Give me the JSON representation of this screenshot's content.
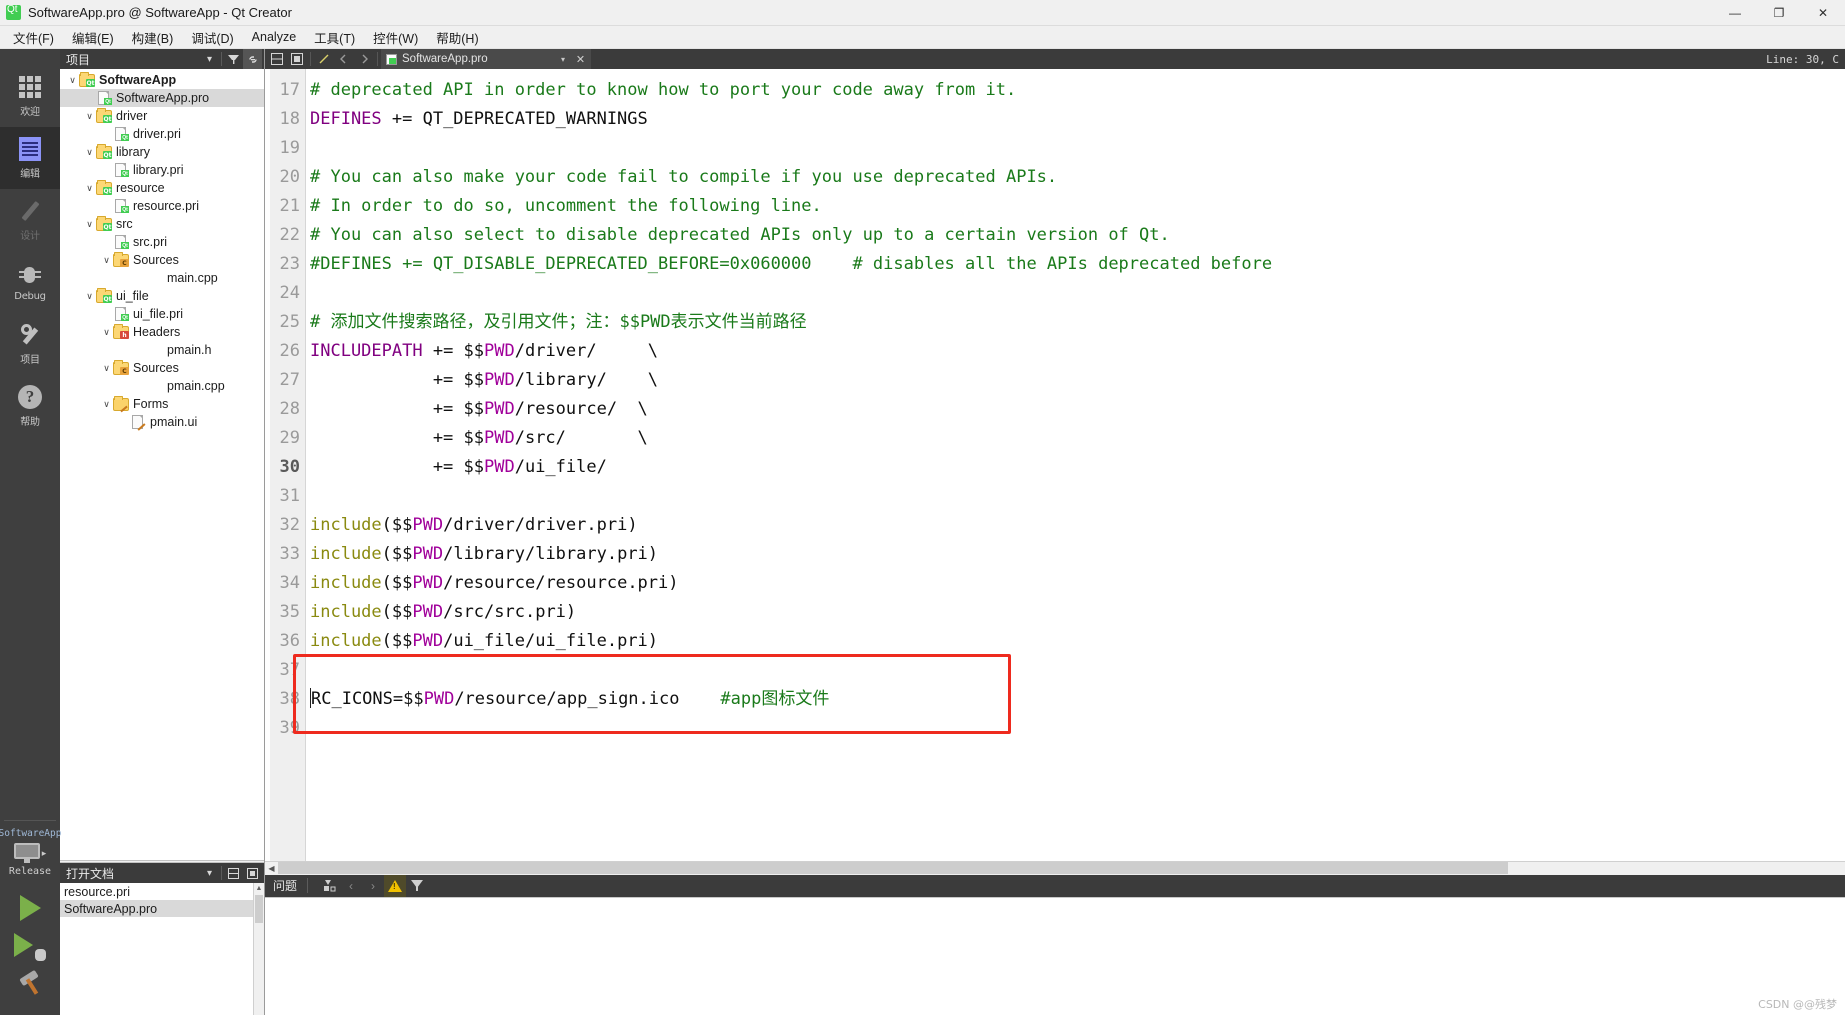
{
  "window": {
    "title": "SoftwareApp.pro @ SoftwareApp - Qt Creator",
    "logo_label": "Qt",
    "minimize": "—",
    "maximize": "❐",
    "close": "✕"
  },
  "menubar": {
    "items": [
      {
        "label": "文件(F)",
        "mnemonic": "F"
      },
      {
        "label": "编辑(E)",
        "mnemonic": "E"
      },
      {
        "label": "构建(B)",
        "mnemonic": "B"
      },
      {
        "label": "调试(D)",
        "mnemonic": "D"
      },
      {
        "label": "Analyze",
        "mnemonic": "A"
      },
      {
        "label": "工具(T)",
        "mnemonic": "T"
      },
      {
        "label": "控件(W)",
        "mnemonic": "W"
      },
      {
        "label": "帮助(H)",
        "mnemonic": "H"
      }
    ]
  },
  "modebar": {
    "modes": [
      {
        "label": "欢迎",
        "icon": "grid-icon",
        "state": "normal"
      },
      {
        "label": "编辑",
        "icon": "document-icon",
        "state": "active"
      },
      {
        "label": "设计",
        "icon": "pencil-icon",
        "state": "disabled"
      },
      {
        "label": "Debug",
        "icon": "bug-icon",
        "state": "normal"
      },
      {
        "label": "项目",
        "icon": "wrench-icon",
        "state": "normal"
      },
      {
        "label": "帮助",
        "icon": "question-icon",
        "state": "normal"
      }
    ],
    "kit": {
      "project_name": "SoftwareApp",
      "build_config": "Release",
      "expand_arrow": "▸"
    },
    "actions": [
      {
        "name": "run-button",
        "label": "Run"
      },
      {
        "name": "debug-button",
        "label": "Start Debugging"
      },
      {
        "name": "build-button",
        "label": "Build"
      }
    ]
  },
  "project_panel": {
    "title": "项目",
    "dropdown_arrow": "▾",
    "filter_icon": "filter-icon",
    "link_icon": "link-icon",
    "tree": [
      {
        "label": "SoftwareApp",
        "indent": 0,
        "twist": "∨",
        "icon": "folder-qt",
        "bold": true,
        "selected": false
      },
      {
        "label": "SoftwareApp.pro",
        "indent": 1,
        "twist": "",
        "icon": "file-qt",
        "bold": false,
        "selected": true
      },
      {
        "label": "driver",
        "indent": 1,
        "twist": "∨",
        "icon": "folder-qt",
        "bold": false,
        "selected": false
      },
      {
        "label": "driver.pri",
        "indent": 2,
        "twist": "",
        "icon": "file-qt",
        "bold": false,
        "selected": false
      },
      {
        "label": "library",
        "indent": 1,
        "twist": "∨",
        "icon": "folder-qt",
        "bold": false,
        "selected": false
      },
      {
        "label": "library.pri",
        "indent": 2,
        "twist": "",
        "icon": "file-qt",
        "bold": false,
        "selected": false
      },
      {
        "label": "resource",
        "indent": 1,
        "twist": "∨",
        "icon": "folder-qt",
        "bold": false,
        "selected": false
      },
      {
        "label": "resource.pri",
        "indent": 2,
        "twist": "",
        "icon": "file-qt",
        "bold": false,
        "selected": false
      },
      {
        "label": "src",
        "indent": 1,
        "twist": "∨",
        "icon": "folder-qt",
        "bold": false,
        "selected": false
      },
      {
        "label": "src.pri",
        "indent": 2,
        "twist": "",
        "icon": "file-qt",
        "bold": false,
        "selected": false
      },
      {
        "label": "Sources",
        "indent": 2,
        "twist": "∨",
        "icon": "folder-cpp",
        "bold": false,
        "selected": false
      },
      {
        "label": "main.cpp",
        "indent": 4,
        "twist": "",
        "icon": "none",
        "bold": false,
        "selected": false
      },
      {
        "label": "ui_file",
        "indent": 1,
        "twist": "∨",
        "icon": "folder-qt",
        "bold": false,
        "selected": false
      },
      {
        "label": "ui_file.pri",
        "indent": 2,
        "twist": "",
        "icon": "file-qt",
        "bold": false,
        "selected": false
      },
      {
        "label": "Headers",
        "indent": 2,
        "twist": "∨",
        "icon": "folder-h",
        "bold": false,
        "selected": false
      },
      {
        "label": "pmain.h",
        "indent": 4,
        "twist": "",
        "icon": "none",
        "bold": false,
        "selected": false
      },
      {
        "label": "Sources",
        "indent": 2,
        "twist": "∨",
        "icon": "folder-cpp",
        "bold": false,
        "selected": false
      },
      {
        "label": "pmain.cpp",
        "indent": 4,
        "twist": "",
        "icon": "none",
        "bold": false,
        "selected": false
      },
      {
        "label": "Forms",
        "indent": 2,
        "twist": "∨",
        "icon": "folder-forms",
        "bold": false,
        "selected": false
      },
      {
        "label": "pmain.ui",
        "indent": 3,
        "twist": "",
        "icon": "file-ui",
        "bold": false,
        "selected": false
      }
    ]
  },
  "open_documents": {
    "title": "打开文档",
    "dropdown_arrow": "▾",
    "split_icon": "split-icon",
    "close_icon": "close-split-icon",
    "items": [
      {
        "label": "resource.pri",
        "selected": false
      },
      {
        "label": "SoftwareApp.pro",
        "selected": true
      }
    ]
  },
  "editor": {
    "toolbar": {
      "split_icon": "split-editor-icon",
      "unsplit_icon": "remove-split-icon",
      "bookmark_icon": "bookmark-icon",
      "back_icon": "navigate-back-icon",
      "forward_icon": "navigate-forward-icon"
    },
    "tab": {
      "filename": "SoftwareApp.pro",
      "dropdown": "▾",
      "close": "✕"
    },
    "status": "Line: 30, C",
    "first_line_number": 17,
    "current_line": 30,
    "lines": [
      {
        "n": 17,
        "tokens": [
          {
            "t": "# deprecated API in order to know how to port your code away from it.",
            "c": "cmt"
          }
        ]
      },
      {
        "n": 18,
        "tokens": [
          {
            "t": "DEFINES",
            "c": "kw"
          },
          {
            "t": " += QT_DEPRECATED_WARNINGS",
            "c": ""
          }
        ]
      },
      {
        "n": 19,
        "tokens": []
      },
      {
        "n": 20,
        "tokens": [
          {
            "t": "# You can also make your code fail to compile if you use deprecated APIs.",
            "c": "cmt"
          }
        ]
      },
      {
        "n": 21,
        "tokens": [
          {
            "t": "# In order to do so, uncomment the following line.",
            "c": "cmt"
          }
        ]
      },
      {
        "n": 22,
        "tokens": [
          {
            "t": "# You can also select to disable deprecated APIs only up to a certain version of Qt.",
            "c": "cmt"
          }
        ]
      },
      {
        "n": 23,
        "tokens": [
          {
            "t": "#DEFINES += QT_DISABLE_DEPRECATED_BEFORE=0x060000    # disables all the APIs deprecated before",
            "c": "cmt"
          }
        ]
      },
      {
        "n": 24,
        "tokens": []
      },
      {
        "n": 25,
        "tokens": [
          {
            "t": "# 添加文件搜索路径，及引用文件；注：$$PWD表示文件当前路径",
            "c": "cmt"
          }
        ]
      },
      {
        "n": 26,
        "tokens": [
          {
            "t": "INCLUDEPATH",
            "c": "kw"
          },
          {
            "t": " += $$",
            "c": ""
          },
          {
            "t": "PWD",
            "c": "pwd"
          },
          {
            "t": "/driver/     \\",
            "c": ""
          }
        ]
      },
      {
        "n": 27,
        "tokens": [
          {
            "t": "            += $$",
            "c": ""
          },
          {
            "t": "PWD",
            "c": "pwd"
          },
          {
            "t": "/library/    \\",
            "c": ""
          }
        ]
      },
      {
        "n": 28,
        "tokens": [
          {
            "t": "            += $$",
            "c": ""
          },
          {
            "t": "PWD",
            "c": "pwd"
          },
          {
            "t": "/resource/  \\",
            "c": ""
          }
        ]
      },
      {
        "n": 29,
        "tokens": [
          {
            "t": "            += $$",
            "c": ""
          },
          {
            "t": "PWD",
            "c": "pwd"
          },
          {
            "t": "/src/       \\",
            "c": ""
          }
        ]
      },
      {
        "n": 30,
        "tokens": [
          {
            "t": "            += $$",
            "c": ""
          },
          {
            "t": "PWD",
            "c": "pwd"
          },
          {
            "t": "/ui_file/",
            "c": ""
          }
        ]
      },
      {
        "n": 31,
        "tokens": []
      },
      {
        "n": 32,
        "tokens": [
          {
            "t": "include",
            "c": "inc"
          },
          {
            "t": "($$",
            "c": ""
          },
          {
            "t": "PWD",
            "c": "pwd"
          },
          {
            "t": "/driver/driver.pri)",
            "c": ""
          }
        ]
      },
      {
        "n": 33,
        "tokens": [
          {
            "t": "include",
            "c": "inc"
          },
          {
            "t": "($$",
            "c": ""
          },
          {
            "t": "PWD",
            "c": "pwd"
          },
          {
            "t": "/library/library.pri)",
            "c": ""
          }
        ]
      },
      {
        "n": 34,
        "tokens": [
          {
            "t": "include",
            "c": "inc"
          },
          {
            "t": "($$",
            "c": ""
          },
          {
            "t": "PWD",
            "c": "pwd"
          },
          {
            "t": "/resource/resource.pri)",
            "c": ""
          }
        ]
      },
      {
        "n": 35,
        "tokens": [
          {
            "t": "include",
            "c": "inc"
          },
          {
            "t": "($$",
            "c": ""
          },
          {
            "t": "PWD",
            "c": "pwd"
          },
          {
            "t": "/src/src.pri)",
            "c": ""
          }
        ]
      },
      {
        "n": 36,
        "tokens": [
          {
            "t": "include",
            "c": "inc"
          },
          {
            "t": "($$",
            "c": ""
          },
          {
            "t": "PWD",
            "c": "pwd"
          },
          {
            "t": "/ui_file/ui_file.pri)",
            "c": ""
          }
        ]
      },
      {
        "n": 37,
        "tokens": []
      },
      {
        "n": 38,
        "tokens": [
          {
            "t": "RC_ICONS=$$",
            "c": ""
          },
          {
            "t": "PWD",
            "c": "pwd"
          },
          {
            "t": "/resource/app_sign.ico    ",
            "c": ""
          },
          {
            "t": "#app图标文件",
            "c": "cmt"
          }
        ]
      },
      {
        "n": 39,
        "tokens": []
      }
    ],
    "annotation": {
      "type": "red-rectangle",
      "color": "#ee2a1e",
      "around_lines": [
        37,
        38,
        39
      ]
    }
  },
  "bottom_bar": {
    "title": "问题",
    "icons": [
      "filter-categories-icon",
      "previous-item-icon",
      "next-item-icon",
      "warning-icon",
      "filter-icon"
    ],
    "prev_arrow": "‹",
    "next_arrow": "›"
  },
  "watermark": "CSDN @@残梦"
}
